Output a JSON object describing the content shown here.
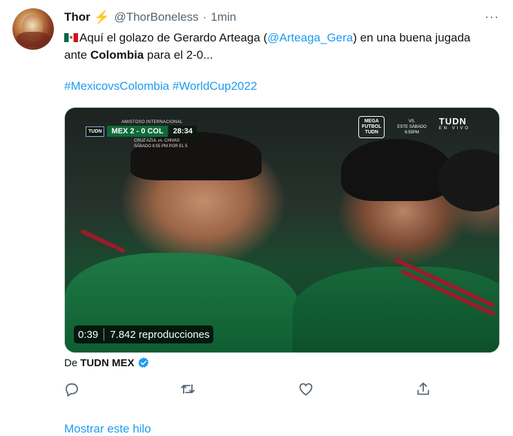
{
  "tweet": {
    "author_name": "Thor",
    "author_emoji": "⚡",
    "handle": "@ThorBoneless",
    "separator": "·",
    "time": "1min",
    "more_label": "···",
    "text_part1": "Aquí el golazo de Gerardo Arteaga (",
    "mention": "@Arteaga_Gera",
    "text_part2": ") en una buena jugada ante ",
    "bold_word": "Colombia",
    "text_part3": " para el 2-0...",
    "hashtag1": "#MexicovsColombia",
    "hashtag2": "#WorldCup2022"
  },
  "video": {
    "duration": "0:39",
    "views": "7.842 reproducciones",
    "scorebug": {
      "competition": "AMISTOSO INTERNACIONAL",
      "logo": "TUDN",
      "home": "MEX",
      "score": "2 - 0",
      "away": "COL",
      "clock": "28:34",
      "promo_line1": "CRUZ AZUL vs. CHIVAS",
      "promo_line2": "SÁBADO 6:55 PM POR EL 5"
    },
    "right_overlay": {
      "mega_line1": "MEGA",
      "mega_line2": "FUTBOL",
      "mega_line3": "TUDN",
      "vs": "VS.",
      "sab_line1": "ESTE SÁBADO",
      "sab_line2": "6:55PM",
      "network": "TUDN",
      "network_sub": "EN VIVO"
    }
  },
  "source": {
    "prefix": "De",
    "name": "TUDN MEX"
  },
  "actions": [
    "reply-icon",
    "retweet-icon",
    "like-icon",
    "share-icon"
  ],
  "show_thread": "Mostrar este hilo",
  "colors": {
    "link": "#1d9bf0",
    "muted": "#536471",
    "verified": "#1d9bf0",
    "bolt": "#f4a81d"
  }
}
